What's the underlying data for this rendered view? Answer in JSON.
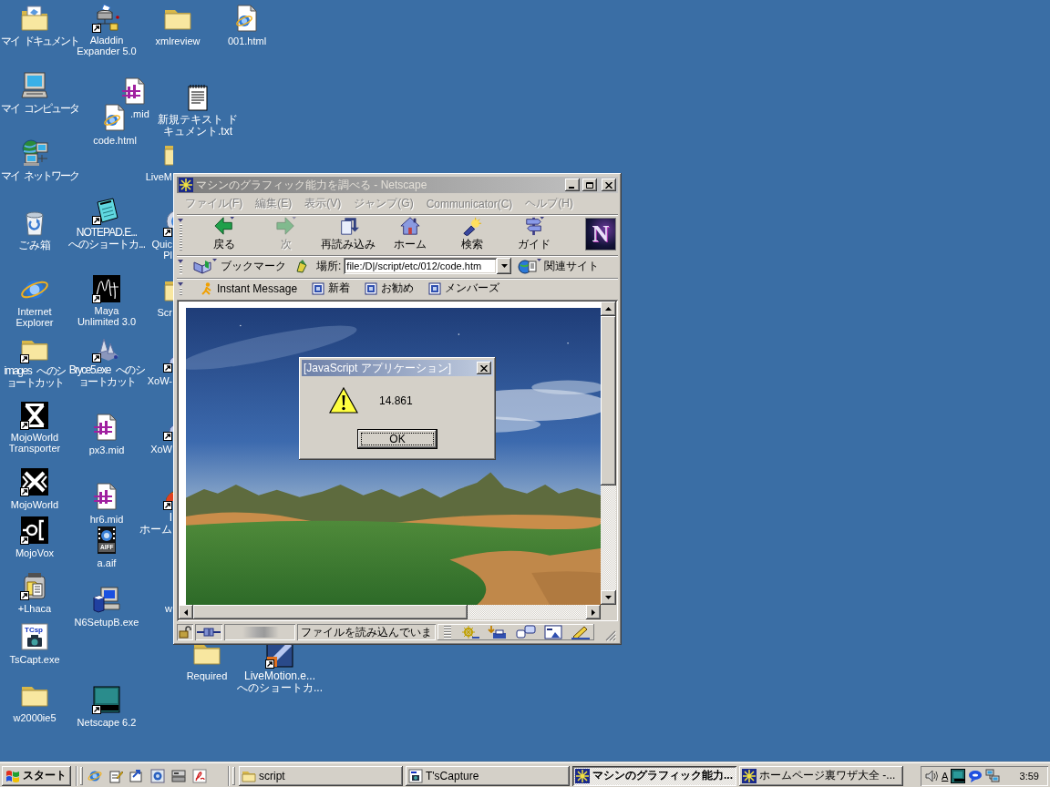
{
  "desktop_icons": [
    {
      "label": "マイ ドキュメント",
      "kind": "my-documents",
      "shortcut": false
    },
    {
      "label": "マイ コンピュータ",
      "kind": "computer",
      "shortcut": false
    },
    {
      "label": "マイ ネットワーク",
      "kind": "network",
      "shortcut": false
    },
    {
      "label": "ごみ箱",
      "kind": "recycle-bin",
      "shortcut": false
    },
    {
      "label": "Internet\nExplorer",
      "kind": "browser",
      "shortcut": false
    },
    {
      "label": "images へのショートカット",
      "kind": "folder",
      "shortcut": true
    },
    {
      "label": "MojoWorld\nTransporter",
      "kind": "transporter",
      "shortcut": true
    },
    {
      "label": "MojoWorld",
      "kind": "mojoworld",
      "shortcut": true
    },
    {
      "label": "MojoVox",
      "kind": "mojovox",
      "shortcut": true
    },
    {
      "label": "+Lhaca",
      "kind": "lhaca",
      "shortcut": true
    },
    {
      "label": "TsCapt.exe",
      "kind": "tscapt",
      "shortcut": false,
      "badge": "TCsp"
    },
    {
      "label": "w2000ie5",
      "kind": "folder",
      "shortcut": false
    },
    {
      "label": "Aladdin\nExpander 5.0",
      "kind": "aladdin",
      "shortcut": true
    },
    {
      "label": ".mid",
      "kind": "midi",
      "shortcut": false
    },
    {
      "label": "code.html",
      "kind": "web-page",
      "shortcut": false
    },
    {
      "label": "NOTEPAD.E...\nへのショートカ...",
      "kind": "notepad",
      "shortcut": true
    },
    {
      "label": "Maya\nUnlimited 3.0",
      "kind": "maya",
      "shortcut": true
    },
    {
      "label": "Bryce5.exe へのショートカット",
      "kind": "bryce",
      "shortcut": true
    },
    {
      "label": "px3.mid",
      "kind": "midi",
      "shortcut": false
    },
    {
      "label": "hr6.mid",
      "kind": "midi",
      "shortcut": false
    },
    {
      "label": "a.aif",
      "kind": "aiff",
      "shortcut": false,
      "badge": "AIFF"
    },
    {
      "label": "N6SetupB.exe",
      "kind": "setup",
      "shortcut": false
    },
    {
      "label": "Netscape 6.2",
      "kind": "netscape",
      "shortcut": true
    },
    {
      "label": "xmlreview",
      "kind": "folder",
      "shortcut": false
    },
    {
      "label": "001.html",
      "kind": "web-page",
      "shortcut": false
    },
    {
      "label": "新規テキスト ドキュメント.txt",
      "kind": "text-file",
      "shortcut": false
    },
    {
      "label": "LiveM",
      "kind": "folder",
      "shortcut": false
    },
    {
      "label": "Quic\nPl",
      "kind": "quicktime",
      "shortcut": true
    },
    {
      "label": "Scr",
      "kind": "folder",
      "shortcut": false
    },
    {
      "label": "XoW-",
      "kind": "person",
      "shortcut": true
    },
    {
      "label": "XoW",
      "kind": "person",
      "shortcut": true
    },
    {
      "label": "I\nホーム",
      "kind": "gauge",
      "shortcut": true
    },
    {
      "label": "w"
    },
    {
      "label": "Required",
      "kind": "folder",
      "shortcut": false
    },
    {
      "label": "LiveMotion.e...\nへのショートカ...",
      "kind": "livemotion",
      "shortcut": true
    }
  ],
  "browser_window": {
    "active": false,
    "title": "マシンのグラフィック能力を調べる - Netscape",
    "menu": [
      {
        "label": "ファイル(F)",
        "disabled": true
      },
      {
        "label": "編集(E)",
        "disabled": true
      },
      {
        "label": "表示(V)",
        "disabled": true
      },
      {
        "label": "ジャンプ(G)",
        "disabled": true
      },
      {
        "label": "Communicator(C)",
        "disabled": true
      },
      {
        "label": "ヘルプ(H)",
        "disabled": true
      }
    ],
    "nav_buttons": [
      {
        "label": "戻る",
        "kind": "back",
        "disabled": false
      },
      {
        "label": "次",
        "kind": "forward",
        "disabled": true
      },
      {
        "label": "再読み込み",
        "kind": "reload",
        "disabled": false
      },
      {
        "label": "ホーム",
        "kind": "home",
        "disabled": false
      },
      {
        "label": "検索",
        "kind": "search",
        "disabled": false
      },
      {
        "label": "ガイド",
        "kind": "guide",
        "disabled": false
      }
    ],
    "throbber": "N",
    "bookmarks": "ブックマーク",
    "location_label": "場所:",
    "location": "file:/D|/script/etc/012/code.htm",
    "related": "関連サイト",
    "personal_toolbar": [
      {
        "label": "Instant Message",
        "kind": "messenger"
      },
      {
        "label": "新着",
        "kind": "page"
      },
      {
        "label": "お勧め",
        "kind": "page"
      },
      {
        "label": "メンバーズ",
        "kind": "page"
      }
    ],
    "status_text": "ファイルを読み込んでいま"
  },
  "dialog": {
    "active": true,
    "title": "[JavaScript アプリケーション]",
    "message": "14.861",
    "button": "OK"
  },
  "taskbar": {
    "start": "スタート",
    "tasks": [
      {
        "label": "script",
        "kind": "folder",
        "selected": false
      },
      {
        "label": "T'sCapture",
        "kind": "capture",
        "selected": false
      },
      {
        "label": "マシンのグラフィック能力...",
        "kind": "netscape",
        "selected": true
      },
      {
        "label": "ホームページ裏ワザ大全 -...",
        "kind": "netscape",
        "selected": false
      }
    ],
    "ime_mode": "A",
    "clock": "3:59"
  }
}
